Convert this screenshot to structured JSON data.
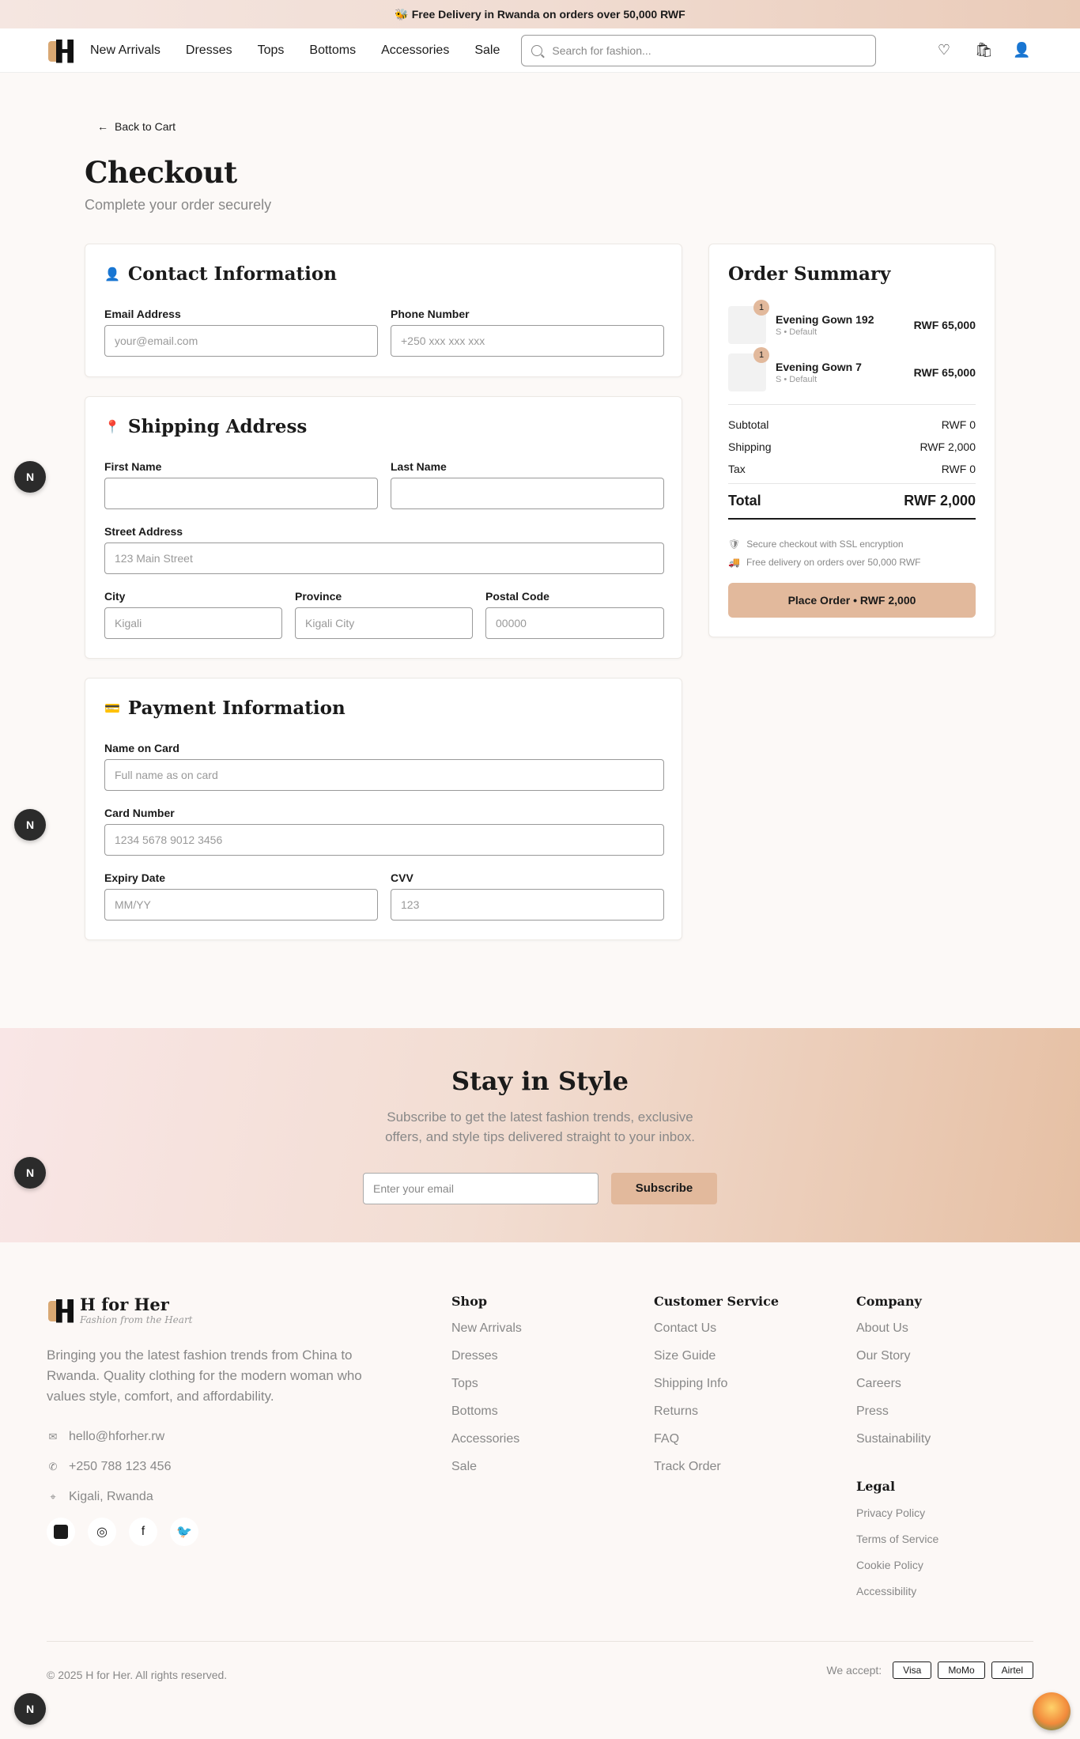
{
  "promo": {
    "icon": "bee-icon",
    "text": "Free Delivery in Rwanda on orders over 50,000 RWF"
  },
  "header": {
    "nav": [
      "New Arrivals",
      "Dresses",
      "Tops",
      "Bottoms",
      "Accessories",
      "Sale"
    ],
    "search_placeholder": "Search for fashion..."
  },
  "back_label": "Back to Cart",
  "page_title": "Checkout",
  "page_subtitle": "Complete your order securely",
  "contact": {
    "title": "Contact Information",
    "email_label": "Email Address",
    "email_placeholder": "your@email.com",
    "phone_label": "Phone Number",
    "phone_placeholder": "+250 xxx xxx xxx"
  },
  "shipping": {
    "title": "Shipping Address",
    "first_label": "First Name",
    "first_placeholder": "",
    "last_label": "Last Name",
    "last_placeholder": "",
    "street_label": "Street Address",
    "street_placeholder": "123 Main Street",
    "city_label": "City",
    "city_placeholder": "Kigali",
    "province_label": "Province",
    "province_placeholder": "Kigali City",
    "postal_label": "Postal Code",
    "postal_placeholder": "00000"
  },
  "payment": {
    "title": "Payment Information",
    "name_label": "Name on Card",
    "name_placeholder": "Full name as on card",
    "number_label": "Card Number",
    "number_placeholder": "1234 5678 9012 3456",
    "expiry_label": "Expiry Date",
    "expiry_placeholder": "MM/YY",
    "cvv_label": "CVV",
    "cvv_placeholder": "123"
  },
  "summary": {
    "title": "Order Summary",
    "items": [
      {
        "qty": "1",
        "name": "Evening Gown 192",
        "variant": "S • Default",
        "price": "RWF 65,000"
      },
      {
        "qty": "1",
        "name": "Evening Gown 7",
        "variant": "S • Default",
        "price": "RWF 65,000"
      }
    ],
    "subtotal_label": "Subtotal",
    "subtotal": "RWF 0",
    "shipping_label": "Shipping",
    "shipping": "RWF 2,000",
    "tax_label": "Tax",
    "tax": "RWF 0",
    "total_label": "Total",
    "total": "RWF 2,000",
    "note_ssl": "Secure checkout with SSL encryption",
    "note_delivery": "Free delivery on orders over 50,000 RWF",
    "place_order": "Place Order • RWF 2,000"
  },
  "newsletter": {
    "title": "Stay in Style",
    "text": "Subscribe to get the latest fashion trends, exclusive offers, and style tips delivered straight to your inbox.",
    "placeholder": "Enter your email",
    "button": "Subscribe"
  },
  "footer": {
    "brand": "H for Her",
    "tagline": "Fashion from the Heart",
    "description": "Bringing you the latest fashion trends from China to Rwanda. Quality clothing for the modern woman who values style, comfort, and affordability.",
    "email": "hello@hforher.rw",
    "phone": "+250 788 123 456",
    "location": "Kigali, Rwanda",
    "shop_title": "Shop",
    "shop_links": [
      "New Arrivals",
      "Dresses",
      "Tops",
      "Bottoms",
      "Accessories",
      "Sale"
    ],
    "service_title": "Customer Service",
    "service_links": [
      "Contact Us",
      "Size Guide",
      "Shipping Info",
      "Returns",
      "FAQ",
      "Track Order"
    ],
    "company_title": "Company",
    "company_links": [
      "About Us",
      "Our Story",
      "Careers",
      "Press",
      "Sustainability"
    ],
    "legal_title": "Legal",
    "legal_links": [
      "Privacy Policy",
      "Terms of Service",
      "Cookie Policy",
      "Accessibility"
    ],
    "copyright": "© 2025 H for Her. All rights reserved.",
    "accept_label": "We accept:",
    "payment_methods": [
      "Visa",
      "MoMo",
      "Airtel"
    ]
  },
  "floating_badge": "N",
  "colors": {
    "accent": "#e2b99c",
    "brand_gold": "#d9a873",
    "text": "#1a1a1a",
    "muted": "#888888"
  }
}
